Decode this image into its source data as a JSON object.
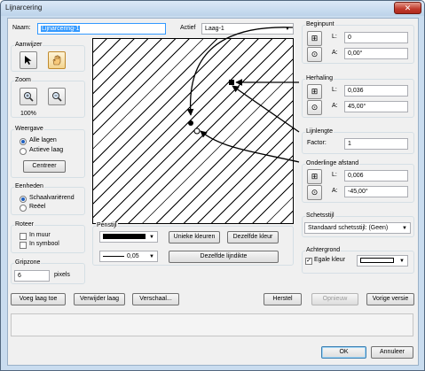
{
  "title": "Lijnarcering",
  "close_glyph": "✕",
  "naam": {
    "label": "Naam:",
    "value": "Lijnarcering-1"
  },
  "actief": {
    "label": "Actief",
    "value": "Laag-1"
  },
  "aanwijzer": {
    "title": "Aanwijzer"
  },
  "zoom": {
    "title": "Zoom",
    "percent": "100%"
  },
  "weergave": {
    "title": "Weergave",
    "alle_lagen": "Alle lagen",
    "actieve_laag": "Actieve laag",
    "centreer": "Centreer"
  },
  "eenheden": {
    "title": "Eenheden",
    "schaalvariered": "Schaalvariërend",
    "reeel": "Reëel"
  },
  "roteer": {
    "title": "Roteer",
    "in_muur": "In muur",
    "in_symbool": "In symbool"
  },
  "gripzone": {
    "title": "Gripzone",
    "value": "6",
    "unit": "pixels"
  },
  "penstijl": {
    "title": "Penstijl",
    "line_weight": "0,05",
    "unieke_kleuren": "Unieke kleuren",
    "dezelfde_kleur": "Dezelfde kleur",
    "dezelfde_lijndikte": "Dezelfde lijndikte"
  },
  "beginpunt": {
    "title": "Beginpunt",
    "l_label": "L:",
    "l_value": "0",
    "a_label": "A:",
    "a_value": "0,00°"
  },
  "herhaling": {
    "title": "Herhaling",
    "l_label": "L:",
    "l_value": "0,036",
    "a_label": "A:",
    "a_value": "45,00°"
  },
  "lijnlengte": {
    "title": "Lijnlengte",
    "factor_label": "Factor:",
    "factor_value": "1"
  },
  "onderlinge": {
    "title": "Onderlinge afstand",
    "l_label": "L:",
    "l_value": "0,006",
    "a_label": "A:",
    "a_value": "-45,00°"
  },
  "schetsstijl": {
    "title": "Schetsstijl",
    "value": "Standaard schetsstijl: (Geen)"
  },
  "achtergrond": {
    "title": "Achtergrond",
    "egale_kleur": "Egale kleur"
  },
  "buttons": {
    "voeg_laag_toe": "Voeg laag toe",
    "verwijder_laag": "Verwijder laag",
    "verschaal": "Verschaal...",
    "herstel": "Herstel",
    "opnieuw": "Opnieuw",
    "vorige_versie": "Vorige versie",
    "ok": "OK",
    "annuleer": "Annuleer"
  },
  "icons": {
    "arrow": "pointer-arrow-icon",
    "hand": "hand-icon",
    "zoom_in": "zoom-in-icon",
    "zoom_out": "zoom-out-icon"
  },
  "colors": {
    "pen": "#000000",
    "title_bar": "#c9dcef",
    "close": "#c0392b",
    "focus_border": "#3399ff"
  }
}
